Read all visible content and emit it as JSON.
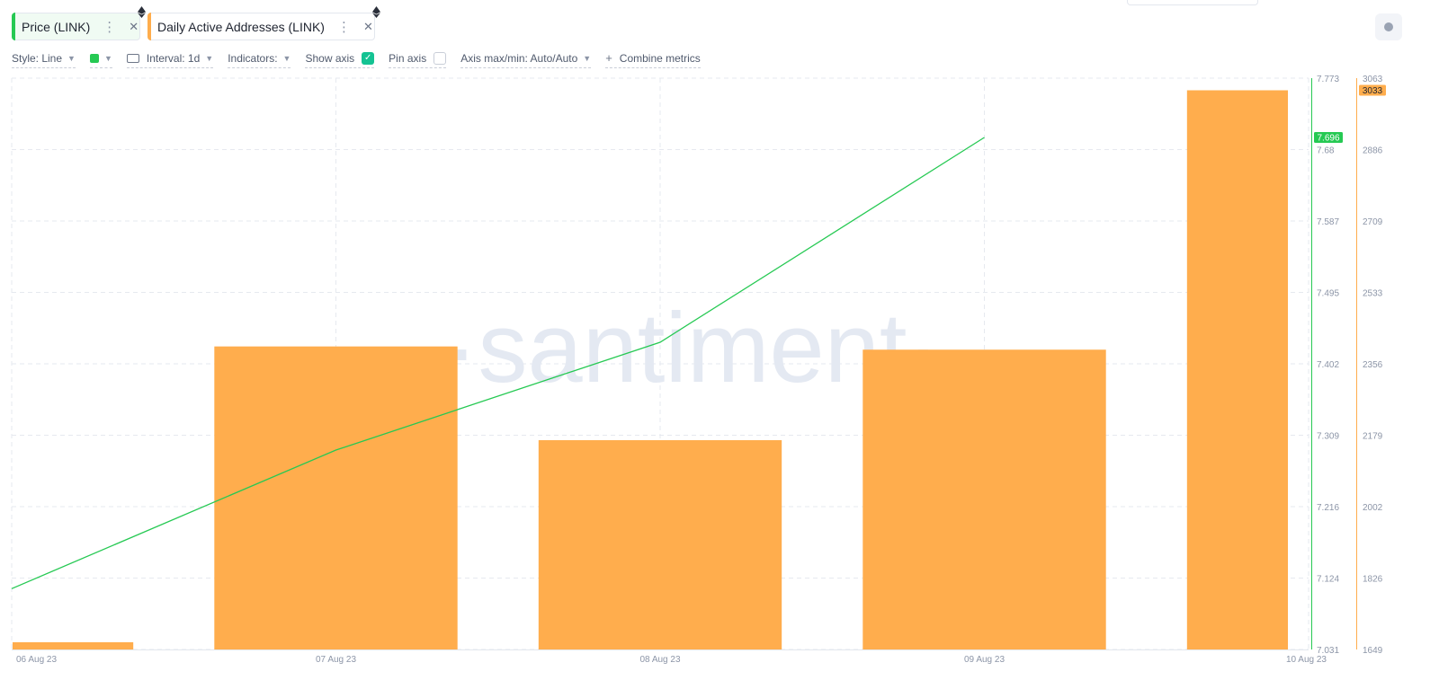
{
  "tabs": [
    {
      "label": "Price (LINK)",
      "color": "#26c953",
      "menu_icon": "kebab-icon",
      "close_icon": "close-icon",
      "chain_icon": "ethereum-icon"
    },
    {
      "label": "Daily Active Addresses (LINK)",
      "color": "#ffad4d",
      "menu_icon": "kebab-icon",
      "close_icon": "close-icon",
      "chain_icon": "ethereum-icon"
    }
  ],
  "toolbar": {
    "style_label": "Style: Line",
    "series_color": "#26c953",
    "interval_label": "Interval: 1d",
    "indicators_label": "Indicators:",
    "show_axis_label": "Show axis",
    "show_axis_checked": true,
    "pin_axis_label": "Pin axis",
    "pin_axis_checked": false,
    "axis_label": "Axis max/min: Auto/Auto",
    "combine_label": "Combine metrics"
  },
  "watermark": "·santiment·",
  "chart_data": {
    "type": "line+bar",
    "x": [
      "06 Aug 23",
      "07 Aug 23",
      "08 Aug 23",
      "09 Aug 23",
      "10 Aug 23"
    ],
    "x_tick_labels": [
      "06 Aug 23",
      "07 Aug 23",
      "08 Aug 23",
      "09 Aug 23",
      "10 Aug 23"
    ],
    "series": [
      {
        "name": "Price (LINK)",
        "type": "line",
        "axis": "left",
        "color": "#26c953",
        "values": [
          7.11,
          7.29,
          7.43,
          7.696,
          null
        ],
        "last_value_label": "7.696"
      },
      {
        "name": "Daily Active Addresses (LINK)",
        "type": "bar",
        "axis": "right",
        "color": "#ffad4d",
        "values": [
          1667,
          2399,
          2167,
          2391,
          3033
        ],
        "last_value_label": "3033"
      }
    ],
    "price_axis": {
      "ticks": [
        "7.773",
        "7.68",
        "7.587",
        "7.495",
        "7.402",
        "7.309",
        "7.216",
        "7.124",
        "7.031"
      ],
      "ylim": [
        7.031,
        7.773
      ],
      "color": "#26c953"
    },
    "daa_axis": {
      "ticks": [
        "3063",
        "2886",
        "2709",
        "2533",
        "2356",
        "2179",
        "2002",
        "1826",
        "1649"
      ],
      "ylim": [
        1649,
        3063
      ],
      "color": "#ffad4d"
    },
    "grid": true
  }
}
